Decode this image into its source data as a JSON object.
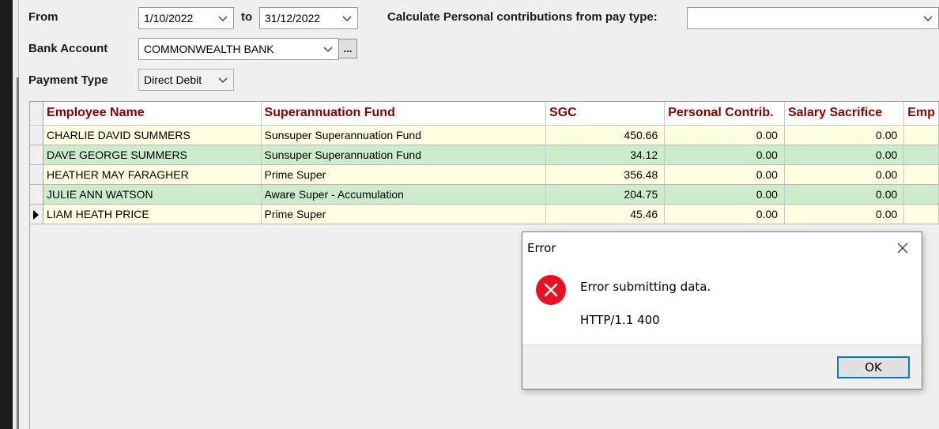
{
  "form": {
    "from_label": "From",
    "from_date": "1/10/2022",
    "to_label": "to",
    "to_date": "31/12/2022",
    "calc_label": "Calculate Personal contributions from pay type:",
    "calc_value": "",
    "bank_label": "Bank Account",
    "bank_value": "COMMONWEALTH BANK",
    "bank_browse": "...",
    "payment_label": "Payment Type",
    "payment_value": "Direct Debit"
  },
  "grid": {
    "columns": [
      "Employee Name",
      "Superannuation Fund",
      "SGC",
      "Personal Contrib.",
      "Salary Sacrifice",
      "Emp"
    ],
    "rows": [
      {
        "name": "CHARLIE DAVID SUMMERS",
        "fund": "Sunsuper Superannuation Fund",
        "sgc": "450.66",
        "personal": "0.00",
        "salary": "0.00",
        "current": false
      },
      {
        "name": "DAVE GEORGE SUMMERS",
        "fund": "Sunsuper Superannuation Fund",
        "sgc": "34.12",
        "personal": "0.00",
        "salary": "0.00",
        "current": false
      },
      {
        "name": "HEATHER MAY FARAGHER",
        "fund": "Prime Super",
        "sgc": "356.48",
        "personal": "0.00",
        "salary": "0.00",
        "current": false
      },
      {
        "name": "JULIE ANN WATSON",
        "fund": "Aware Super - Accumulation",
        "sgc": "204.75",
        "personal": "0.00",
        "salary": "0.00",
        "current": false
      },
      {
        "name": "LIAM HEATH PRICE",
        "fund": "Prime Super",
        "sgc": "45.46",
        "personal": "0.00",
        "salary": "0.00",
        "current": true
      }
    ],
    "row_colors": [
      "#ffffe1",
      "#cdeccd"
    ],
    "header_color": "#8b0000"
  },
  "dialog": {
    "title": "Error",
    "message": "Error submitting data.",
    "detail": "HTTP/1.1 400",
    "ok_label": "OK",
    "icon": "error-icon",
    "icon_color": "#e81123",
    "accent": "#0078d7"
  }
}
